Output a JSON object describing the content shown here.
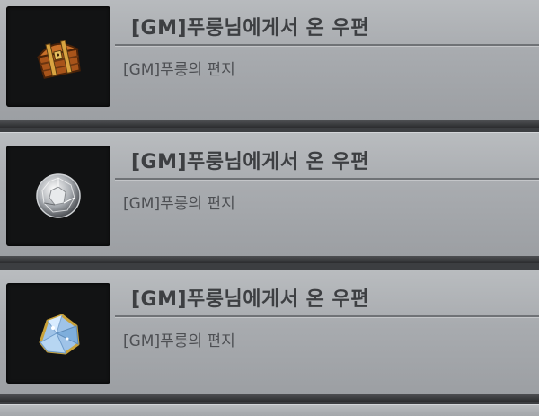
{
  "mails": [
    {
      "title": "[GM]푸룽님에게서 온 우편",
      "subtitle": "[GM]푸룽의 편지",
      "icon": "treasure-chest-icon"
    },
    {
      "title": "[GM]푸룽님에게서 온 우편",
      "subtitle": "[GM]푸룽의 편지",
      "icon": "diamond-gem-icon"
    },
    {
      "title": "[GM]푸룽님에게서 온 우편",
      "subtitle": "[GM]푸룽의 편지",
      "icon": "crystal-ore-icon"
    }
  ],
  "colors": {
    "panel": "#a8abaf",
    "slot": "#121314",
    "title_text": "#3d3f42",
    "subtitle_text": "#4e5054",
    "chest": "#b8651f"
  }
}
